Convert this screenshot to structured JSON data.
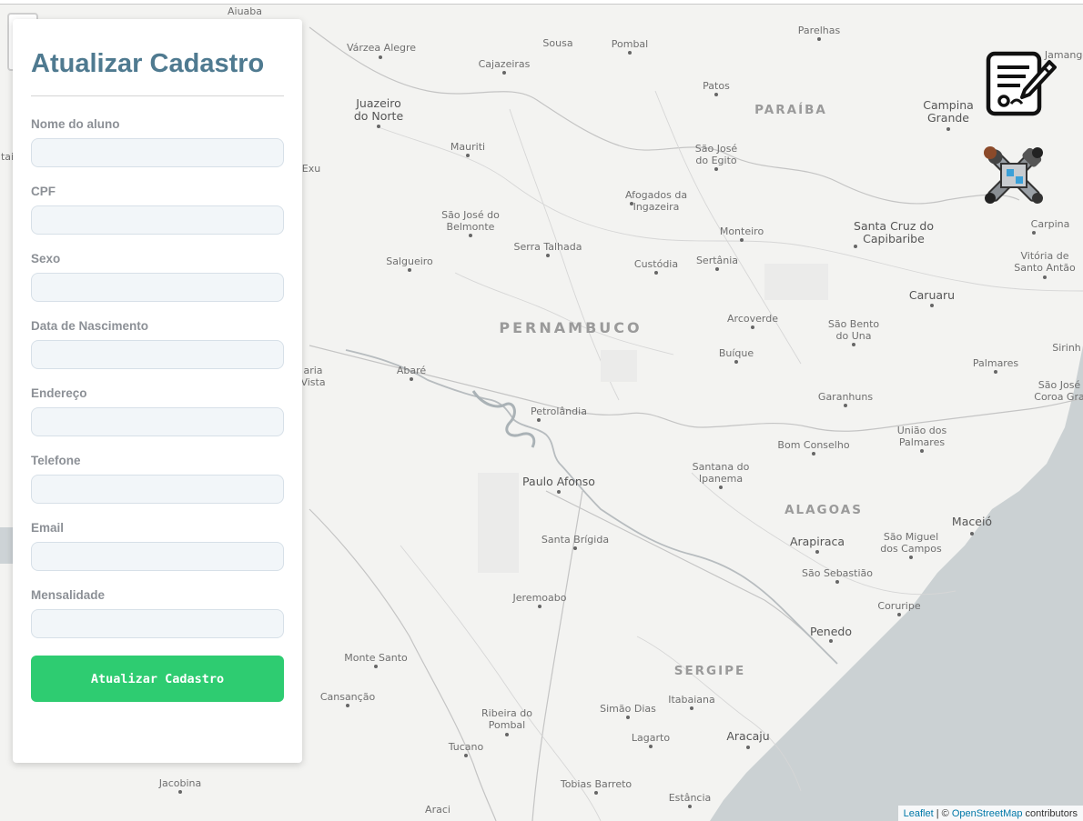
{
  "form": {
    "title": "Atualizar Cadastro",
    "fields": [
      {
        "label": "Nome do aluno",
        "value": "",
        "placeholder": ""
      },
      {
        "label": "CPF",
        "value": "",
        "placeholder": ""
      },
      {
        "label": "Sexo",
        "value": "",
        "placeholder": ""
      },
      {
        "label": "Data de Nascimento",
        "value": "",
        "placeholder": ""
      },
      {
        "label": "Endereço",
        "value": "",
        "placeholder": ""
      },
      {
        "label": "Telefone",
        "value": "",
        "placeholder": ""
      },
      {
        "label": "Email",
        "value": "",
        "placeholder": ""
      },
      {
        "label": "Mensalidade",
        "value": "",
        "placeholder": ""
      }
    ],
    "submit_label": "Atualizar Cadastro",
    "submit_color": "#2ecc71",
    "title_color": "#4f7a90"
  },
  "map": {
    "states": [
      "PARAÍBA",
      "PERNAMBUCO",
      "ALAGOAS",
      "SERGIPE"
    ],
    "places": {
      "aiuaba": "Aiuaba",
      "varzea_alegre": "Várzea Alegre",
      "sousa": "Sousa",
      "pombal": "Pombal",
      "parelhas": "Parelhas",
      "lamego": "Jamange",
      "cajazeiras": "Cajazeiras",
      "juazeiro": "Juazeiro\ndo Norte",
      "patos": "Patos",
      "campina_grande": "Campina\nGrande",
      "mauriti": "Mauriti",
      "sao_jose_egito": "São José\ndo Egito",
      "exu": "Exu",
      "afogados": "Afogados da\nIngazeira",
      "sao_jose_belmonte": "São José do\nBelmonte",
      "monteiro": "Monteiro",
      "santa_cruz": "Santa Cruz do\nCapibaribe",
      "carpina": "Carpina",
      "serra_talhada": "Serra Talhada",
      "salgueiro": "Salgueiro",
      "custodia": "Custódia",
      "sertania": "Sertânia",
      "vitoria": "Vitória de\nSanto Antão",
      "caruaru": "Caruaru",
      "arcoverde": "Arcoverde",
      "sao_bento": "São Bento\ndo Una",
      "sirinhaem": "Sirinh",
      "buique": "Buíque",
      "palmares": "Palmares",
      "abare": "Abaré",
      "maria_vista": "aria\nVista",
      "sao_jose_coroa": "São José\nCoroa Gra",
      "garanhuns": "Garanhuns",
      "petrolandia": "Petrolândia",
      "uniao_palmares": "União dos\nPalmares",
      "bom_conselho": "Bom Conselho",
      "santana_ipanema": "Santana do\nIpanema",
      "paulo_afonso": "Paulo Afonso",
      "maceio": "Maceió",
      "arapiraca": "Arapiraca",
      "sao_miguel": "São Miguel\ndos Campos",
      "santa_brigida": "Santa Brígida",
      "sao_sebastiao": "São Sebastião",
      "jeremoabo": "Jeremoabo",
      "coruripe": "Coruripe",
      "penedo": "Penedo",
      "monte_santo": "Monte Santo",
      "cansancao": "Cansanção",
      "itabaiana": "Itabaiana",
      "ribeira": "Ribeira do\nPombal",
      "simao_dias": "Simão Dias",
      "lagarto": "Lagarto",
      "aracaju": "Aracaju",
      "tucano": "Tucano",
      "jacobina": "Jacobina",
      "tobias_barreto": "Tobias Barreto",
      "estancia": "Estância",
      "araci": "Araci",
      "tai": "tai"
    },
    "attribution": {
      "leaflet": "Leaflet",
      "sep": " | © ",
      "osm": "OpenStreetMap",
      "suffix": " contributors"
    }
  },
  "icons": {
    "document": "document-edit-icon",
    "tools": "tools-icon"
  }
}
